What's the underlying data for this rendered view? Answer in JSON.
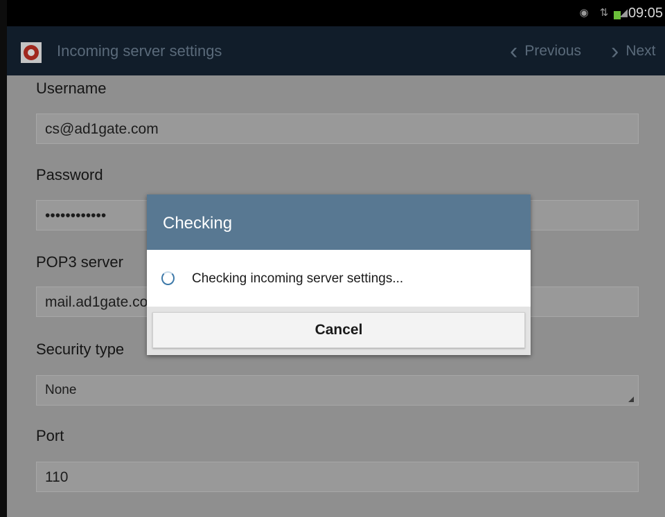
{
  "status_bar": {
    "time": "09:05"
  },
  "action_bar": {
    "title": "Incoming server settings",
    "previous_label": "Previous",
    "next_label": "Next"
  },
  "form": {
    "username_label": "Username",
    "username_value": "cs@ad1gate.com",
    "password_label": "Password",
    "password_value": "••••••••••••",
    "pop3_label": "POP3 server",
    "pop3_value": "mail.ad1gate.com",
    "security_label": "Security type",
    "security_value": "None",
    "port_label": "Port",
    "port_value": "110"
  },
  "dialog": {
    "title": "Checking",
    "message": "Checking incoming server settings...",
    "cancel_label": "Cancel"
  },
  "colors": {
    "action_bar": "#111d2a",
    "dialog_header": "#587892",
    "dim_overlay": "#8f8f8f",
    "battery": "#6bbf3a"
  }
}
